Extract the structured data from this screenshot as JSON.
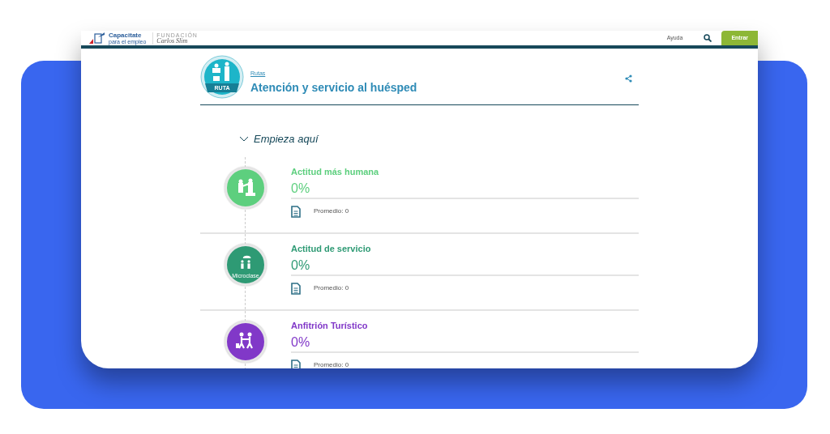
{
  "header": {
    "logo_title": "Capacitate",
    "logo_subtitle": "para el empleo",
    "foundation_label": "FUNDACIÓN",
    "foundation_name": "Carlos Slim",
    "help_link": "Ayuda",
    "login_button": "Entrar"
  },
  "route": {
    "badge_label": "RUTA",
    "breadcrumb": "Rutas",
    "title": "Atención y servicio al huésped"
  },
  "section": {
    "title": "Empieza aquí",
    "expanded": true
  },
  "courses": [
    {
      "kind": "helping",
      "title": "Actitud más humana",
      "progress": "0%",
      "average": "Promedio: 0",
      "color": "#5dcf7e"
    },
    {
      "kind": "umbrella",
      "badge_label": "Microclase",
      "title": "Actitud de servicio",
      "progress": "0%",
      "average": "Promedio: 0",
      "color": "#2e9a74"
    },
    {
      "kind": "greeting",
      "title": "Anfitrión Turístico",
      "progress": "0%",
      "average": "Promedio: 0",
      "color": "#8138c8"
    }
  ]
}
